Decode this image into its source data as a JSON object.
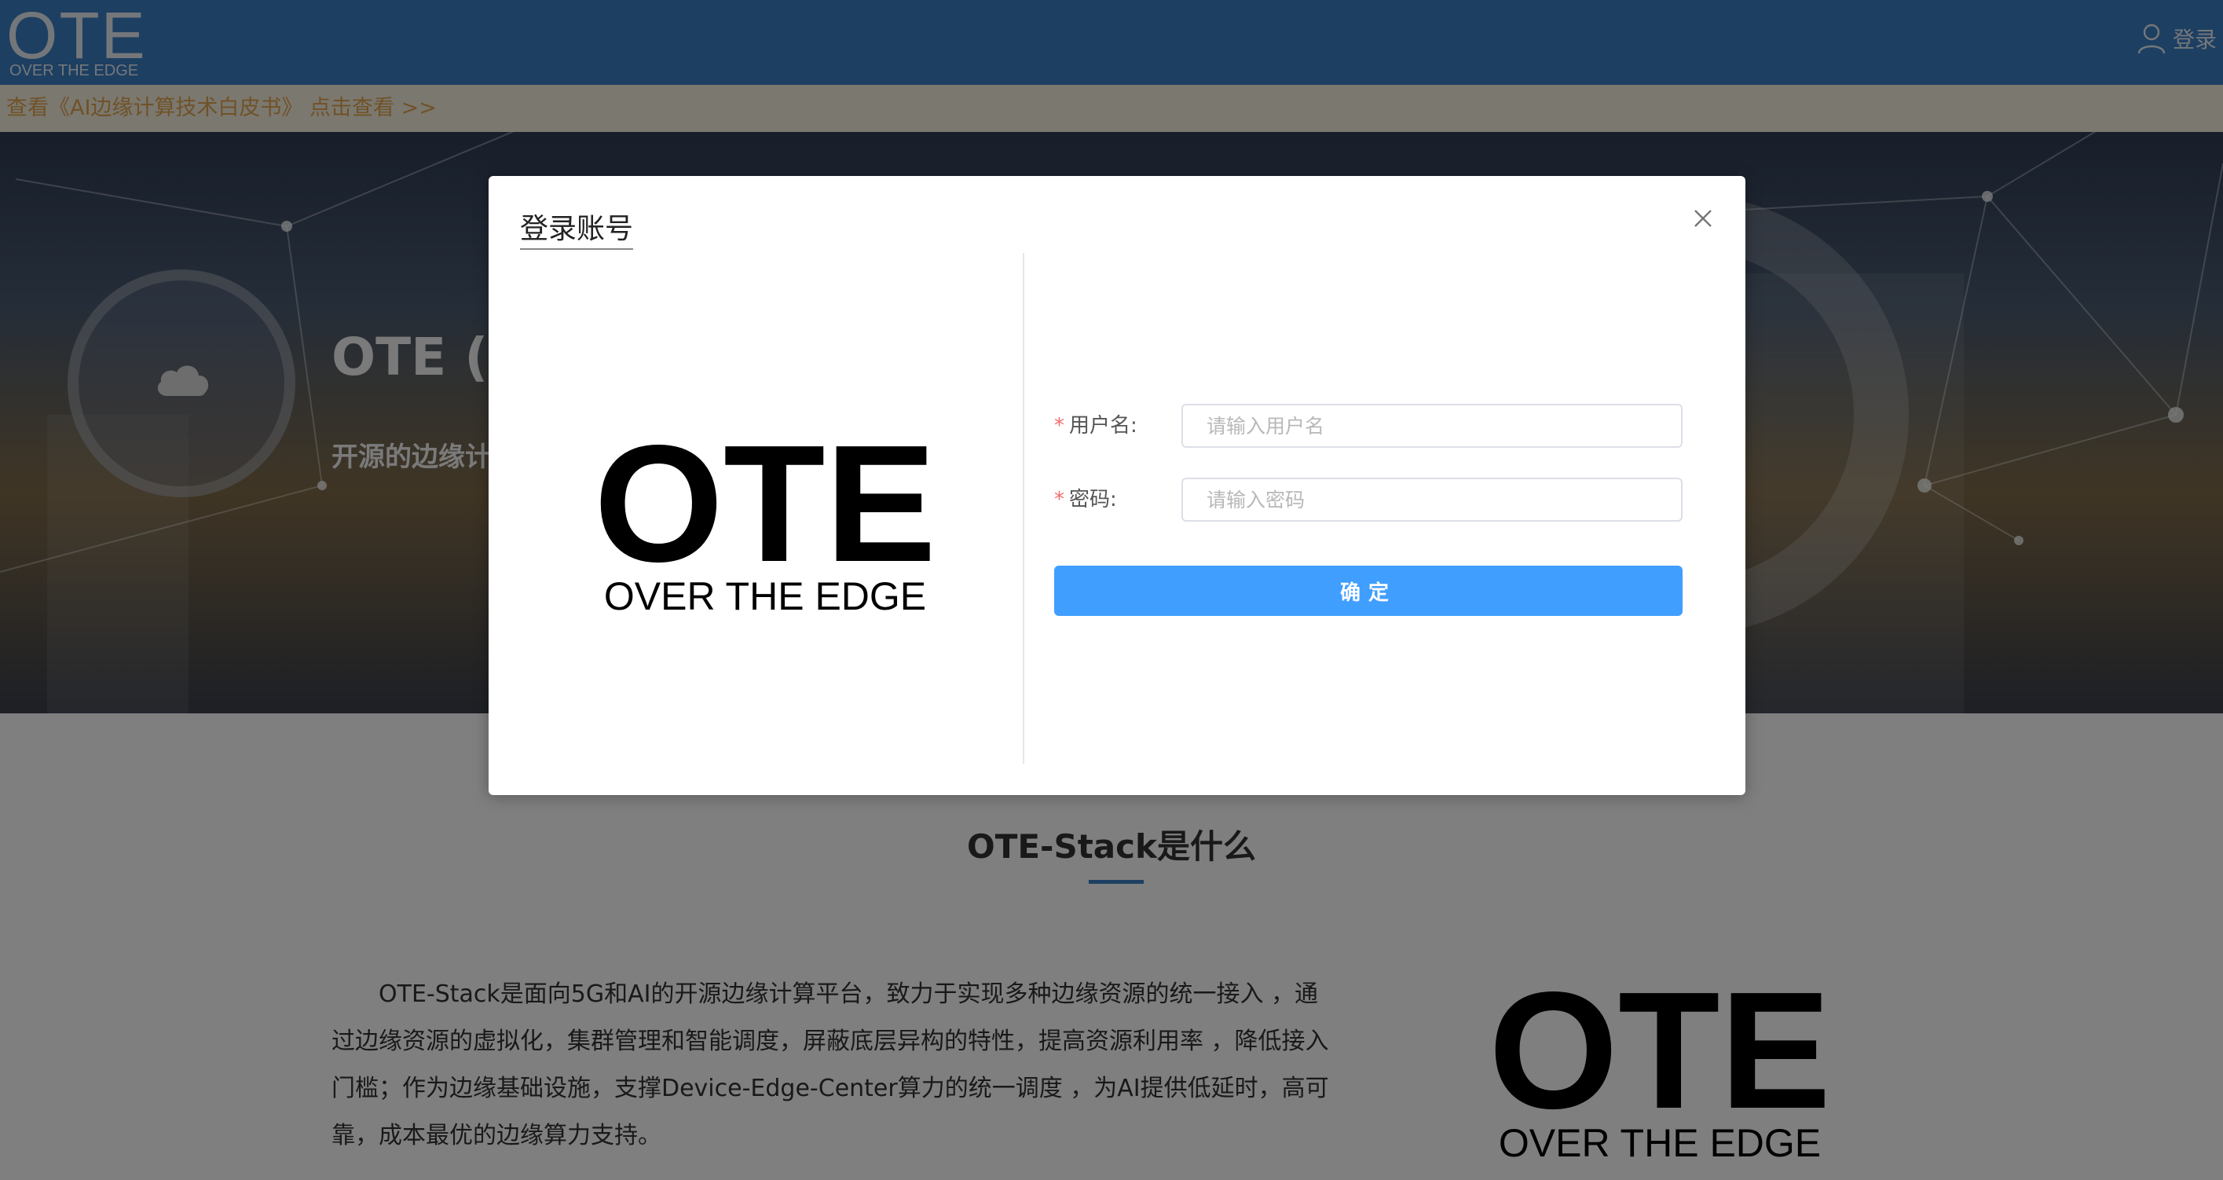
{
  "header": {
    "logo_main": "OTE",
    "logo_sub": "OVER THE EDGE",
    "login_label": "登录",
    "login_icon": "user-icon"
  },
  "notice": {
    "text": "查看《AI边缘计算技术白皮书》 点击查看 >>"
  },
  "hero": {
    "title": "OTE (C",
    "subtitle": "开源的边缘计",
    "cloud_icon": "cloud-icon"
  },
  "content": {
    "section_title": "OTE-Stack是什么",
    "intro": "OTE-Stack是面向5G和AI的开源边缘计算平台，致力于实现多种边缘资源的统一接入 ，通过边缘资源的虚拟化，集群管理和智能调度，屏蔽底层异构的特性，提高资源利用率 ，降低接入门槛；作为边缘基础设施，支撑Device-Edge-Center算力的统一调度 ，为AI提供低延时，高可靠，成本最优的边缘算力支持。",
    "logo_main": "OTE",
    "logo_sub": "OVER THE EDGE"
  },
  "modal": {
    "title": "登录账号",
    "close_icon": "close-icon",
    "logo_main": "OTE",
    "logo_sub": "OVER THE EDGE",
    "username_label": "用户名:",
    "username_placeholder": "请输入用户名",
    "password_label": "密码:",
    "password_placeholder": "请输入密码",
    "required_mark": "*",
    "submit_label": "确定"
  },
  "colors": {
    "primary": "#409eff",
    "nav": "#3a7ec4",
    "notice_text": "#e0a54c",
    "required": "#f56c6c"
  }
}
